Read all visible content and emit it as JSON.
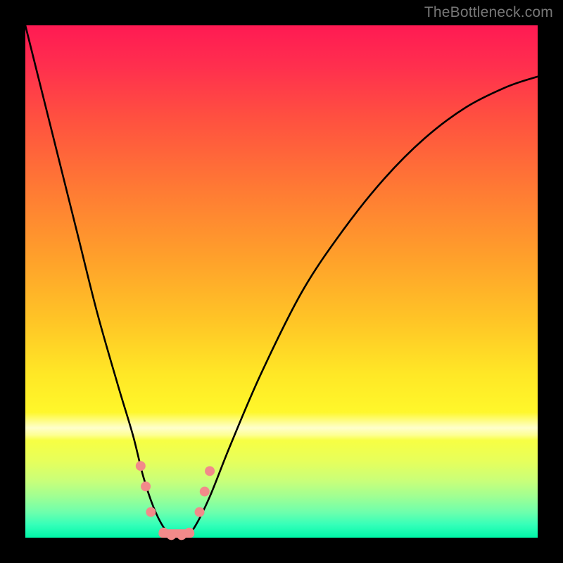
{
  "watermark": "TheBottleneck.com",
  "chart_data": {
    "type": "line",
    "title": "",
    "xlabel": "",
    "ylabel": "",
    "xlim": [
      0,
      100
    ],
    "ylim": [
      0,
      100
    ],
    "background": "rainbow-gradient",
    "series": [
      {
        "name": "bottleneck-curve",
        "x": [
          0,
          5,
          10,
          14,
          18,
          21,
          23,
          25,
          27,
          29,
          31,
          33,
          36,
          40,
          46,
          54,
          62,
          70,
          78,
          86,
          94,
          100
        ],
        "values": [
          100,
          80,
          60,
          44,
          30,
          20,
          12,
          6,
          2,
          0,
          0,
          2,
          8,
          18,
          32,
          48,
          60,
          70,
          78,
          84,
          88,
          90
        ]
      }
    ],
    "markers": {
      "name": "threshold-dots",
      "color": "#f28a8a",
      "points": [
        {
          "x": 22.5,
          "y": 14
        },
        {
          "x": 23.5,
          "y": 10
        },
        {
          "x": 24.5,
          "y": 5
        },
        {
          "x": 27.0,
          "y": 1
        },
        {
          "x": 28.5,
          "y": 0.5
        },
        {
          "x": 30.5,
          "y": 0.5
        },
        {
          "x": 32.0,
          "y": 1
        },
        {
          "x": 34.0,
          "y": 5
        },
        {
          "x": 35.0,
          "y": 9
        },
        {
          "x": 36.0,
          "y": 13
        }
      ]
    },
    "floor_bar": {
      "x0": 26.0,
      "x1": 33.0,
      "y": 0.8,
      "color": "#f28a8a"
    }
  }
}
